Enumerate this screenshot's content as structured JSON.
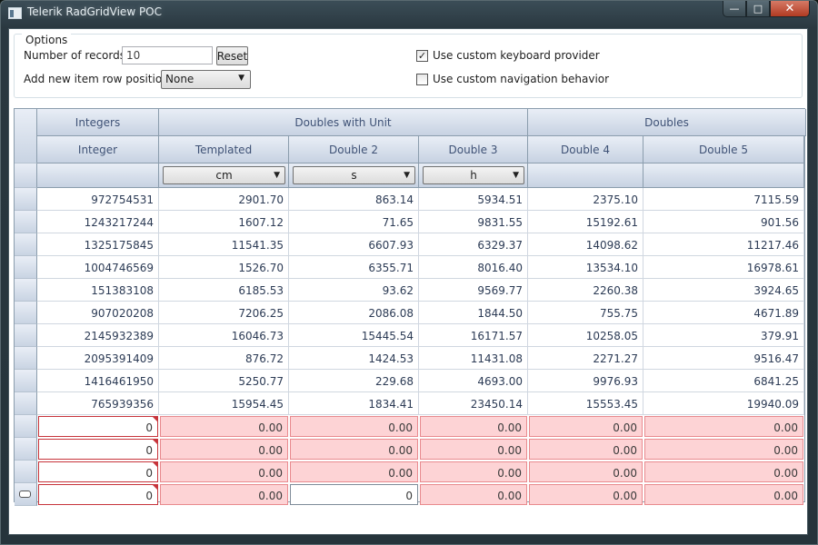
{
  "window": {
    "title": "Telerik RadGridView POC",
    "close_glyph": "✕",
    "minimize_glyph": "—",
    "maximize_glyph": "□"
  },
  "options": {
    "group_label": "Options",
    "records_label": "Number of records:",
    "records_value": "10",
    "reset_label": "Reset",
    "row_position_label": "Add new item row position:",
    "row_position_value": "None",
    "keyboard_provider_label": "Use custom keyboard provider",
    "keyboard_provider_checked": true,
    "navigation_label": "Use custom navigation behavior",
    "navigation_checked": false,
    "check_glyph": "✓",
    "dropdown_glyph": "▼"
  },
  "grid": {
    "group_headers": [
      "Integers",
      "Doubles with Unit",
      "Doubles"
    ],
    "columns": [
      "Integer",
      "Templated",
      "Double 2",
      "Double 3",
      "Double 4",
      "Double 5"
    ],
    "unit_filters": [
      "cm",
      "s",
      "h"
    ],
    "rows": [
      [
        "972754531",
        "2901.70",
        "863.14",
        "5934.51",
        "2375.10",
        "7115.59"
      ],
      [
        "1243217244",
        "1607.12",
        "71.65",
        "9831.55",
        "15192.61",
        "901.56"
      ],
      [
        "1325175845",
        "11541.35",
        "6607.93",
        "6329.37",
        "14098.62",
        "11217.46"
      ],
      [
        "1004746569",
        "1526.70",
        "6355.71",
        "8016.40",
        "13534.10",
        "16978.61"
      ],
      [
        "151383108",
        "6185.53",
        "93.62",
        "9569.77",
        "2260.38",
        "3924.65"
      ],
      [
        "907020208",
        "7206.25",
        "2086.08",
        "1844.50",
        "755.75",
        "4671.89"
      ],
      [
        "2145932389",
        "16046.73",
        "15445.54",
        "16171.57",
        "10258.05",
        "379.91"
      ],
      [
        "2095391409",
        "876.72",
        "1424.53",
        "11431.08",
        "2271.27",
        "9516.47"
      ],
      [
        "1416461950",
        "5250.77",
        "229.68",
        "4693.00",
        "9976.93",
        "6841.25"
      ],
      [
        "765939356",
        "15954.45",
        "1834.41",
        "23450.14",
        "15553.45",
        "19940.09"
      ]
    ],
    "new_rows": [
      [
        "0",
        "0.00",
        "0.00",
        "0.00",
        "0.00",
        "0.00"
      ],
      [
        "0",
        "0.00",
        "0.00",
        "0.00",
        "0.00",
        "0.00"
      ],
      [
        "0",
        "0.00",
        "0.00",
        "0.00",
        "0.00",
        "0.00"
      ],
      [
        "0",
        "0.00",
        "0",
        "0.00",
        "0.00",
        "0.00"
      ]
    ],
    "editing_cell": {
      "row": 3,
      "column": 2
    }
  }
}
